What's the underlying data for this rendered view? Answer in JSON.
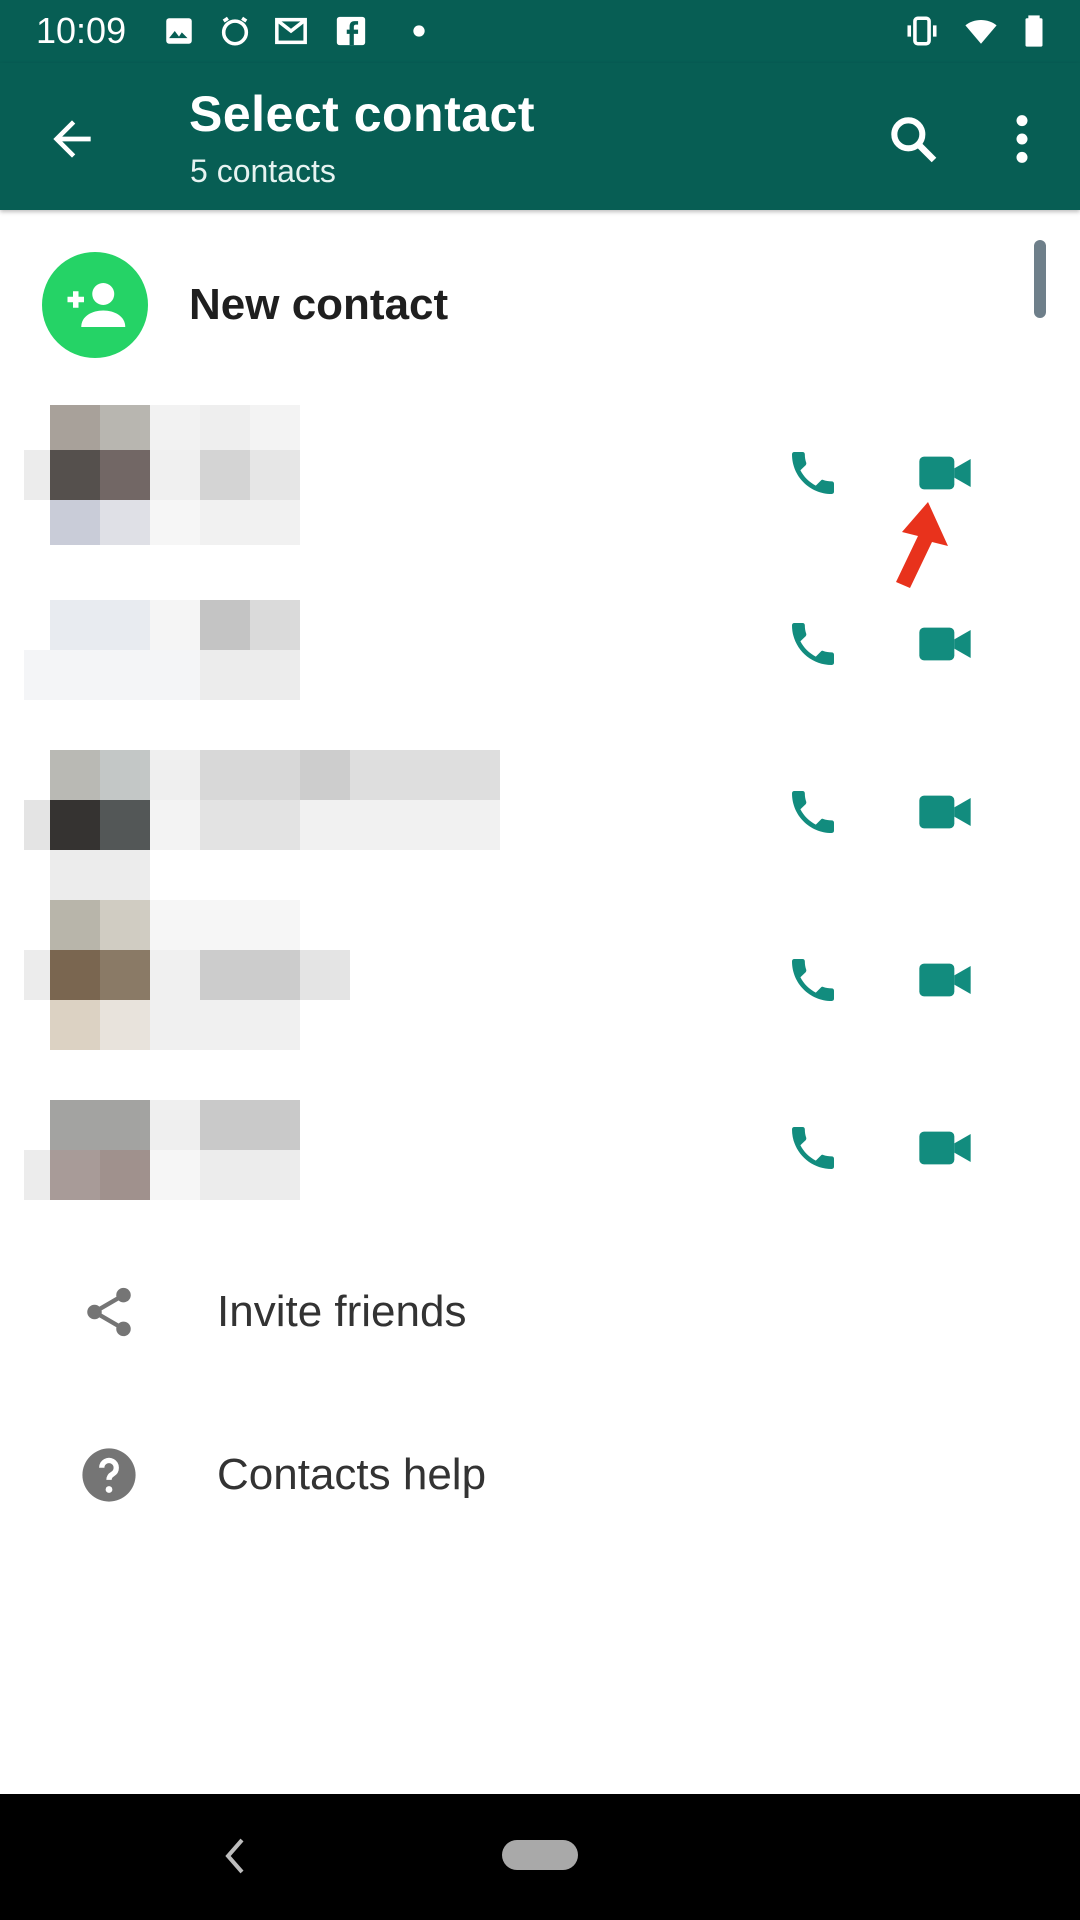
{
  "status_bar": {
    "time": "10:09",
    "icons": [
      "image-icon",
      "alarm-icon",
      "gmail-icon",
      "facebook-icon",
      "dot-icon",
      "vibrate-icon",
      "wifi-icon",
      "battery-icon"
    ]
  },
  "app_bar": {
    "title": "Select contact",
    "subtitle": "5 contacts",
    "icons": [
      "back-arrow-icon",
      "search-icon",
      "more-vert-icon"
    ]
  },
  "new_contact": {
    "label": "New contact",
    "icon": "add-person-icon",
    "color": "#25d366"
  },
  "contacts": [
    {
      "name_redacted": true
    },
    {
      "name_redacted": true
    },
    {
      "name_redacted": true
    },
    {
      "name_redacted": true
    },
    {
      "name_redacted": true
    }
  ],
  "actions": {
    "call_icon": "phone-icon",
    "video_icon": "video-call-icon",
    "accent": "#128c7e",
    "annotation": "red-arrow-pointing-to-video-call"
  },
  "menu": {
    "invite_friends": "Invite friends",
    "contacts_help": "Contacts help"
  },
  "colors": {
    "primary": "#075e54",
    "accent": "#128c7e",
    "green": "#25d366",
    "arrow": "#e8321c"
  }
}
